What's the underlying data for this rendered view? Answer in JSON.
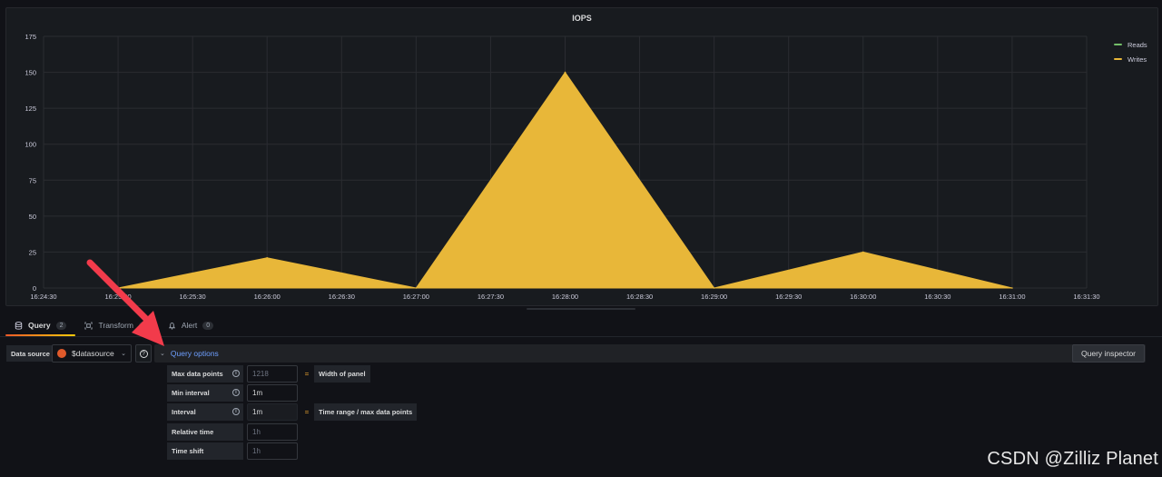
{
  "panel": {
    "title": "IOPS"
  },
  "chart_data": {
    "type": "area",
    "title": "IOPS",
    "xlabel": "",
    "ylabel": "",
    "ylim": [
      0,
      175
    ],
    "yticks": [
      "0",
      "25",
      "50",
      "75",
      "100",
      "125",
      "150",
      "175"
    ],
    "xlim": [
      "16:24:30",
      "16:31:30"
    ],
    "xticks": [
      "16:24:30",
      "16:25:00",
      "16:25:30",
      "16:26:00",
      "16:26:30",
      "16:27:00",
      "16:27:30",
      "16:28:00",
      "16:28:30",
      "16:29:00",
      "16:29:30",
      "16:30:00",
      "16:30:30",
      "16:31:00",
      "16:31:30"
    ],
    "grid": true,
    "legend_position": "top-right",
    "series": [
      {
        "name": "Reads",
        "color": "#73bf69",
        "x": [],
        "values": []
      },
      {
        "name": "Writes",
        "color": "#e8b739",
        "x": [
          "16:25:00",
          "16:26:00",
          "16:27:00",
          "16:28:00",
          "16:29:00",
          "16:30:00",
          "16:31:00"
        ],
        "values": [
          0,
          21,
          0,
          150,
          0,
          25,
          0
        ]
      }
    ]
  },
  "tabs": [
    {
      "label": "Query",
      "count": "2",
      "icon": "database-icon",
      "active": true
    },
    {
      "label": "Transform",
      "count": "0",
      "icon": "transform-icon",
      "active": false
    },
    {
      "label": "Alert",
      "count": "0",
      "icon": "bell-icon",
      "active": false
    }
  ],
  "datasource": {
    "label": "Data source",
    "value": "$datasource",
    "help": "?"
  },
  "query_options": {
    "label": "Query options",
    "inspector_label": "Query inspector"
  },
  "options": [
    {
      "label": "Max data points",
      "value": "1218",
      "placeholder": true,
      "derived": "Width of panel"
    },
    {
      "label": "Min interval",
      "value": "1m",
      "placeholder": false,
      "derived": ""
    },
    {
      "label": "Interval",
      "value": "1m",
      "placeholder": false,
      "derived": "Time range / max data points"
    },
    {
      "label": "Relative time",
      "value": "1h",
      "placeholder": true,
      "derived": ""
    },
    {
      "label": "Time shift",
      "value": "1h",
      "placeholder": true,
      "derived": ""
    }
  ],
  "equals": "=",
  "info": "i",
  "watermark": "CSDN @Zilliz Planet",
  "colors": {
    "accent": "#6e9fff",
    "arrow": "#f23b4b"
  }
}
